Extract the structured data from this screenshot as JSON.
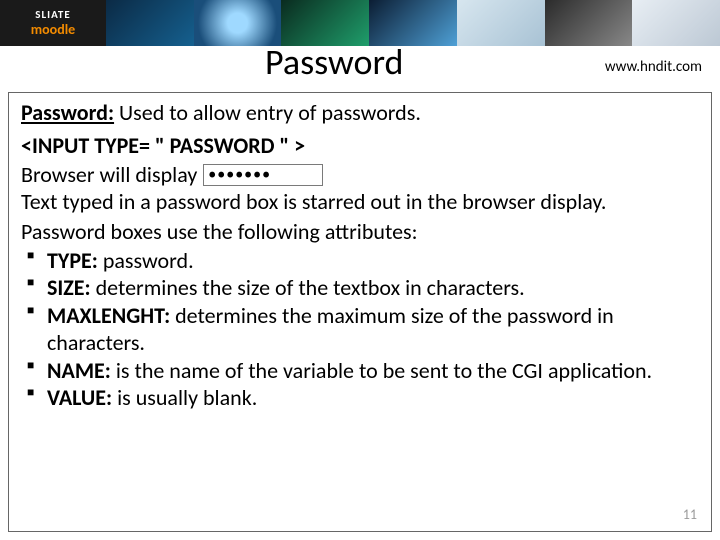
{
  "banner": {
    "logo_line1": "SLIATE",
    "logo_line2": "moodle"
  },
  "header": {
    "title": "Password",
    "url": "www.hndit.com"
  },
  "body": {
    "lead_key": "Password:",
    "lead_rest": " Used to allow entry of passwords.",
    "code_line": "<INPUT TYPE= \" PASSWORD \" >",
    "browser_label": "Browser will display",
    "password_dots": "•••••••",
    "para1": "Text typed in a password box is starred out in the browser display.",
    "attr_intro": "Password boxes use the following attributes:",
    "bullets": [
      {
        "k": "TYPE:",
        "t": " password."
      },
      {
        "k": "SIZE:",
        "t": " determines the size of the textbox in characters."
      },
      {
        "k": "MAXLENGHT:",
        "t": " determines the maximum size of the password in characters."
      },
      {
        "k": "NAME:",
        "t": " is the name of the variable to be sent to the CGI application."
      },
      {
        "k": "VALUE:",
        "t": " is usually blank."
      }
    ]
  },
  "page_number": "11"
}
